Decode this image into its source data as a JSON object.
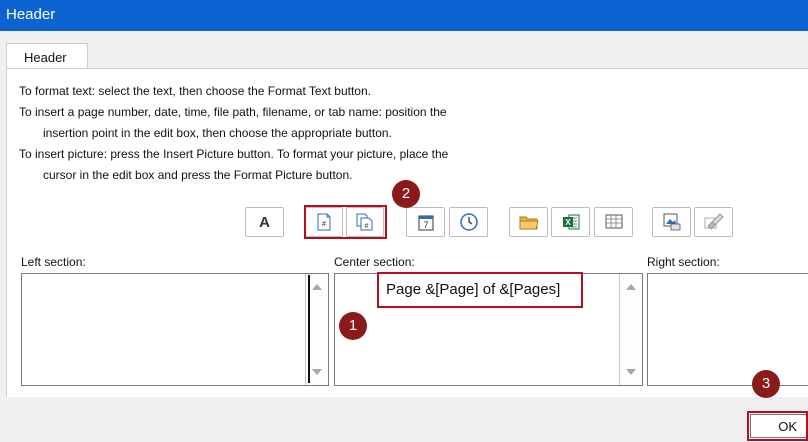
{
  "window": {
    "title": "Header"
  },
  "tabs": [
    {
      "label": "Header"
    }
  ],
  "instructions": [
    "To format text:  select the text, then choose the Format Text button.",
    "To insert a page number, date, time, file path, filename, or tab name:  position the",
    "insertion point in the edit box, then choose the appropriate button.",
    "To insert picture: press the Insert Picture button.  To format your picture, place the",
    "cursor in the edit box and press the Format Picture button."
  ],
  "toolbar": [
    {
      "name": "format-text-icon",
      "glyph": "A"
    },
    {
      "name": "insert-page-number-icon"
    },
    {
      "name": "insert-number-of-pages-icon"
    },
    {
      "name": "insert-date-icon",
      "glyph": "7"
    },
    {
      "name": "insert-time-icon"
    },
    {
      "name": "insert-file-path-icon"
    },
    {
      "name": "insert-file-name-icon"
    },
    {
      "name": "insert-sheet-name-icon"
    },
    {
      "name": "insert-picture-icon"
    },
    {
      "name": "format-picture-icon"
    }
  ],
  "sections": {
    "left": {
      "label": "Left section:",
      "value": ""
    },
    "center": {
      "label": "Center section:",
      "value": "Page &[Page] of &[Pages]"
    },
    "right": {
      "label": "Right section:",
      "value": ""
    }
  },
  "callouts": [
    "1",
    "2",
    "3"
  ],
  "buttons": {
    "ok": "OK"
  },
  "colors": {
    "titlebar": "#0c64d2",
    "callout": "#8b1a1a",
    "highlight": "#b01020",
    "excel_green": "#1d6f42"
  }
}
